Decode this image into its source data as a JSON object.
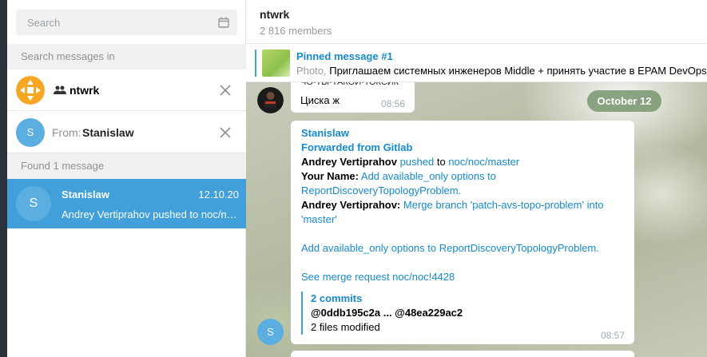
{
  "sidebar": {
    "search_placeholder": "Search",
    "search_in_label": "Search messages in",
    "filters": [
      {
        "label": "ntwrk"
      },
      {
        "from_label": "From:",
        "from_name": "Stanislaw",
        "avatar_letter": "S"
      }
    ],
    "found_label": "Found 1 message",
    "result": {
      "avatar_letter": "S",
      "name": "Stanislaw",
      "date": "12.10.20",
      "preview": "Andrey Vertiprahov pushed to noc/noc/master"
    }
  },
  "chat": {
    "title": "ntwrk",
    "members": "2 816 members",
    "pinned": {
      "title": "Pinned message #1",
      "kind": "Photo,",
      "text": "Приглашаем системных инженеров Middle + принять участие в EPAM DevOps"
    },
    "messages": [
      {
        "partial_top": "ЧО-ТЫ-ТАКОЙ-ТОКСИК",
        "text": "Циска ж",
        "time": "08:56"
      }
    ],
    "date_separator": "October 12",
    "forward": {
      "sender": "Stanislaw",
      "forwarded_from": "Forwarded from Gitlab",
      "author1": "Andrey Vertiprahov",
      "pushed_word": "pushed",
      "to_word": "to",
      "repo_link": "noc/noc/master",
      "your_name_label": "Your Name:",
      "your_name_msg": "Add available_only options to ReportDiscoveryTopologyProblem.",
      "author2": "Andrey Vertiprahov:",
      "merge_msg": "Merge branch 'patch-avs-topo-problem' into 'master'",
      "body_line": "Add available_only options to ReportDiscoveryTopologyProblem.",
      "see_merge": "See merge request noc/noc!4428",
      "commits_title": "2 commits",
      "commit_range": "@0ddb195c2a ... @48ea229ac2",
      "files": "2 files modified",
      "time": "08:57",
      "avatar_letter": "S"
    }
  },
  "colors": {
    "accent": "#419fd9",
    "link": "#168acd",
    "date_pill": "#789670",
    "group_avatar": "#f5a623"
  }
}
